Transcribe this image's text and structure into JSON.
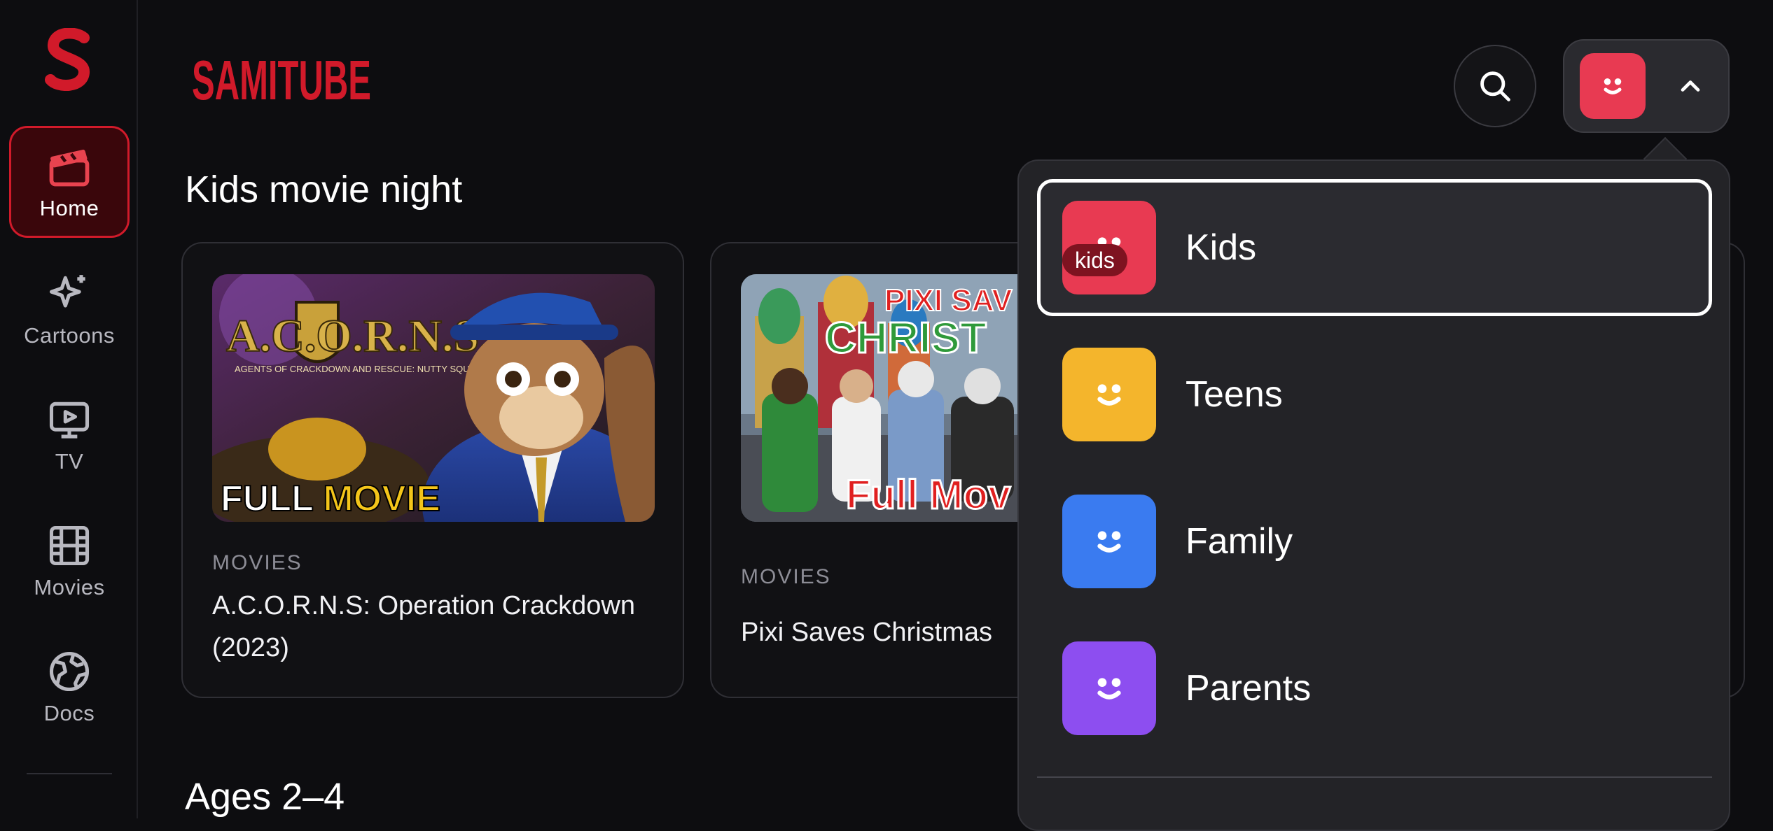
{
  "brand": {
    "initial": "S",
    "name": "SAMITUBE"
  },
  "sidebar": {
    "items": [
      {
        "label": "Home",
        "icon": "clapperboard-icon",
        "active": true
      },
      {
        "label": "Cartoons",
        "icon": "sparkles-icon",
        "active": false
      },
      {
        "label": "TV",
        "icon": "tv-play-icon",
        "active": false
      },
      {
        "label": "Movies",
        "icon": "film-icon",
        "active": false
      },
      {
        "label": "Docs",
        "icon": "globe-icon",
        "active": false
      }
    ]
  },
  "header": {
    "search_icon": "search-icon",
    "profile_icon": "smiley-icon",
    "chevron_icon": "chevron-up-icon"
  },
  "sections": [
    {
      "title": "Kids movie night",
      "cards": [
        {
          "category": "MOVIES",
          "title": "A.C.O.R.N.S: Operation Crackdown (2023)",
          "thumb_text": {
            "logo": "A.C.O.R.N.S.",
            "subtitle": "AGENTS OF CRACKDOWN AND RESCUE: NUTTY SQUIRRELS",
            "banner_a": "FULL ",
            "banner_b": "MOVIE"
          }
        },
        {
          "category": "MOVIES",
          "title": "Pixi Saves Christmas",
          "thumb_text": {
            "top": "PIXI SAV",
            "mid": "CHRIST",
            "banner": "Full Mov"
          }
        }
      ]
    },
    {
      "title": "Ages 2–4"
    }
  ],
  "profiles_menu": {
    "selected": "Kids",
    "selected_tag": "kids",
    "items": [
      {
        "name": "Kids",
        "color": "#e83a52"
      },
      {
        "name": "Teens",
        "color": "#f4b52c"
      },
      {
        "name": "Family",
        "color": "#3a7bf0"
      },
      {
        "name": "Parents",
        "color": "#8d4ef0"
      }
    ]
  },
  "colors": {
    "accent": "#d11a2a",
    "background": "#0d0d10",
    "panel": "#232327"
  }
}
